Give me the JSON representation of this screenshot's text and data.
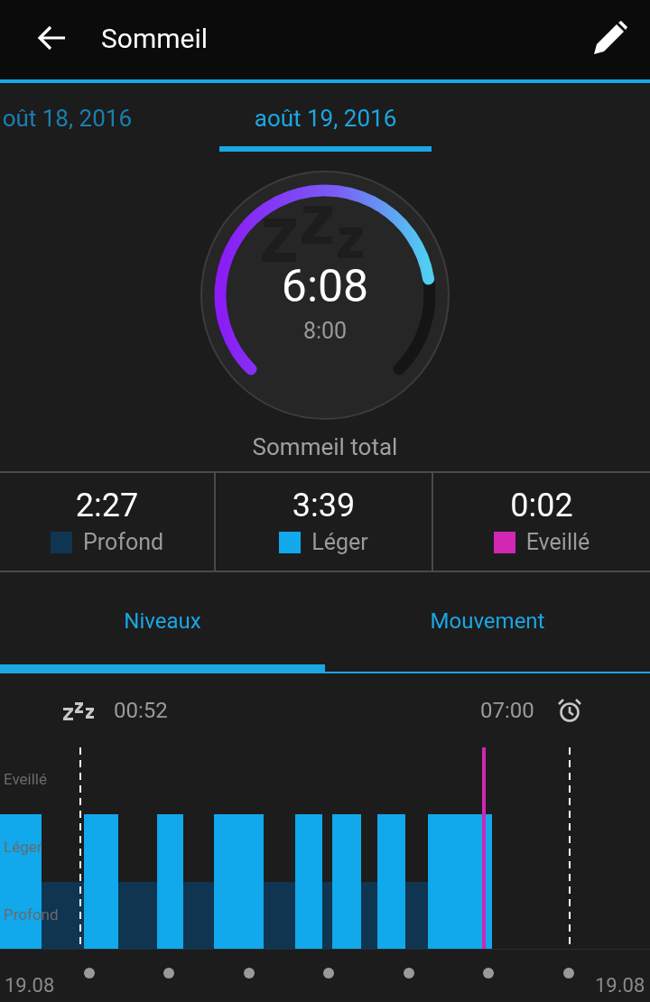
{
  "header": {
    "title": "Sommeil"
  },
  "date_tabs": [
    {
      "label": "oût 18, 2016",
      "selected": false
    },
    {
      "label": "août 19, 2016",
      "selected": true
    }
  ],
  "gauge": {
    "value": "6:08",
    "goal": "8:00",
    "label": "Sommeil total"
  },
  "stages": [
    {
      "duration": "2:27",
      "label": "Profond",
      "color": "#0f3551"
    },
    {
      "duration": "3:39",
      "label": "Léger",
      "color": "#11a8ec"
    },
    {
      "duration": "0:02",
      "label": "Eveillé",
      "color": "#d226b4"
    }
  ],
  "view_tabs": [
    {
      "label": "Niveaux",
      "selected": true
    },
    {
      "label": "Mouvement",
      "selected": false
    }
  ],
  "timeline": {
    "start": "00:52",
    "end": "07:00",
    "levels": [
      "Eveillé",
      "Léger",
      "Profond"
    ],
    "date_start": "19.08",
    "date_end": "19.08"
  }
}
